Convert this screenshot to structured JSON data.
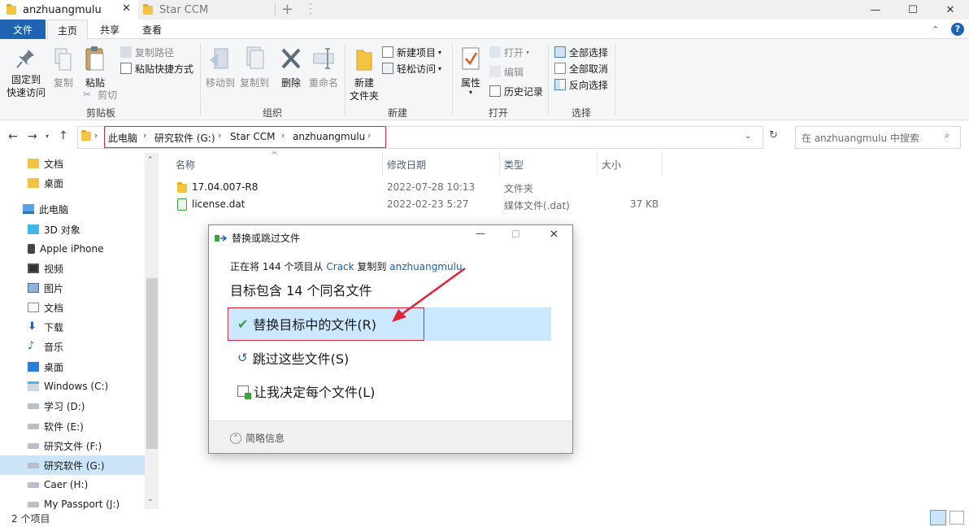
{
  "window": {
    "tabs": [
      {
        "label": "anzhuangmulu",
        "active": true
      },
      {
        "label": "Star CCM",
        "active": false
      }
    ],
    "new_tab_glyph": "+",
    "controls": {
      "minimize": "—",
      "maximize": "☐",
      "close": "✕"
    }
  },
  "ribbon_tabs": {
    "file": "文件",
    "home": "主页",
    "share": "共享",
    "view": "查看"
  },
  "ribbon": {
    "clipboard": {
      "pin_line1": "固定到",
      "pin_line2": "快速访问",
      "copy": "复制",
      "paste": "粘贴",
      "copy_path": "复制路径",
      "paste_shortcut": "粘贴快捷方式",
      "cut": "剪切",
      "label": "剪贴板"
    },
    "organize": {
      "move_to": "移动到",
      "copy_to": "复制到",
      "delete": "删除",
      "rename": "重命名",
      "label": "组织"
    },
    "new": {
      "new_folder_line1": "新建",
      "new_folder_line2": "文件夹",
      "new_item": "新建项目",
      "easy_access": "轻松访问",
      "label": "新建"
    },
    "open": {
      "properties": "属性",
      "open": "打开",
      "edit": "编辑",
      "history": "历史记录",
      "label": "打开"
    },
    "select": {
      "select_all": "全部选择",
      "select_none": "全部取消",
      "invert": "反向选择",
      "label": "选择"
    }
  },
  "address": {
    "crumbs": [
      "此电脑",
      "研究软件 (G:)",
      "Star CCM",
      "anzhuangmulu"
    ],
    "search_placeholder": "在 anzhuangmulu 中搜索"
  },
  "nav_pane": {
    "items": [
      {
        "label": "文档",
        "icon": "folder-icon",
        "selected": false
      },
      {
        "label": "桌面",
        "icon": "folder-icon",
        "selected": false
      },
      {
        "label": "此电脑",
        "icon": "computer-icon",
        "selected": false
      },
      {
        "label": "3D 对象",
        "icon": "cube-icon",
        "selected": false
      },
      {
        "label": "Apple iPhone",
        "icon": "phone-icon",
        "selected": false
      },
      {
        "label": "视频",
        "icon": "video-icon",
        "selected": false
      },
      {
        "label": "图片",
        "icon": "picture-icon",
        "selected": false
      },
      {
        "label": "文档",
        "icon": "document-icon",
        "selected": false
      },
      {
        "label": "下载",
        "icon": "download-icon",
        "selected": false
      },
      {
        "label": "音乐",
        "icon": "music-icon",
        "selected": false
      },
      {
        "label": "桌面",
        "icon": "desktop-icon",
        "selected": false
      },
      {
        "label": "Windows (C:)",
        "icon": "windows-drive-icon",
        "selected": false
      },
      {
        "label": "学习 (D:)",
        "icon": "drive-icon",
        "selected": false
      },
      {
        "label": "软件 (E:)",
        "icon": "drive-icon",
        "selected": false
      },
      {
        "label": "研究文件 (F:)",
        "icon": "drive-icon",
        "selected": false
      },
      {
        "label": "研究软件 (G:)",
        "icon": "drive-icon",
        "selected": true
      },
      {
        "label": "Caer (H:)",
        "icon": "drive-icon",
        "selected": false
      },
      {
        "label": "My Passport (J:)",
        "icon": "drive-icon",
        "selected": false
      }
    ]
  },
  "file_list": {
    "columns": [
      "名称",
      "修改日期",
      "类型",
      "大小"
    ],
    "rows": [
      {
        "name": "17.04.007-R8",
        "date": "2022-07-28 10:13",
        "type": "文件夹",
        "size": "",
        "icon": "folder-icon"
      },
      {
        "name": "license.dat",
        "date": "2022-02-23 5:27",
        "type": "媒体文件(.dat)",
        "size": "37 KB",
        "icon": "dat-file-icon"
      }
    ]
  },
  "status_bar": {
    "item_count": "2 个项目"
  },
  "dialog": {
    "title": "替换或跳过文件",
    "info_prefix": "正在将 144 个项目从",
    "info_source": "Crack",
    "info_mid": "复制到",
    "info_dest": "anzhuangmulu",
    "heading": "目标包含 14 个同名文件",
    "option_replace": "替换目标中的文件(R)",
    "option_skip": "跳过这些文件(S)",
    "option_decide": "让我决定每个文件(L)",
    "less_info": "简略信息",
    "accent_color": "#cce8ff",
    "annotation_color": "#e0243a"
  }
}
